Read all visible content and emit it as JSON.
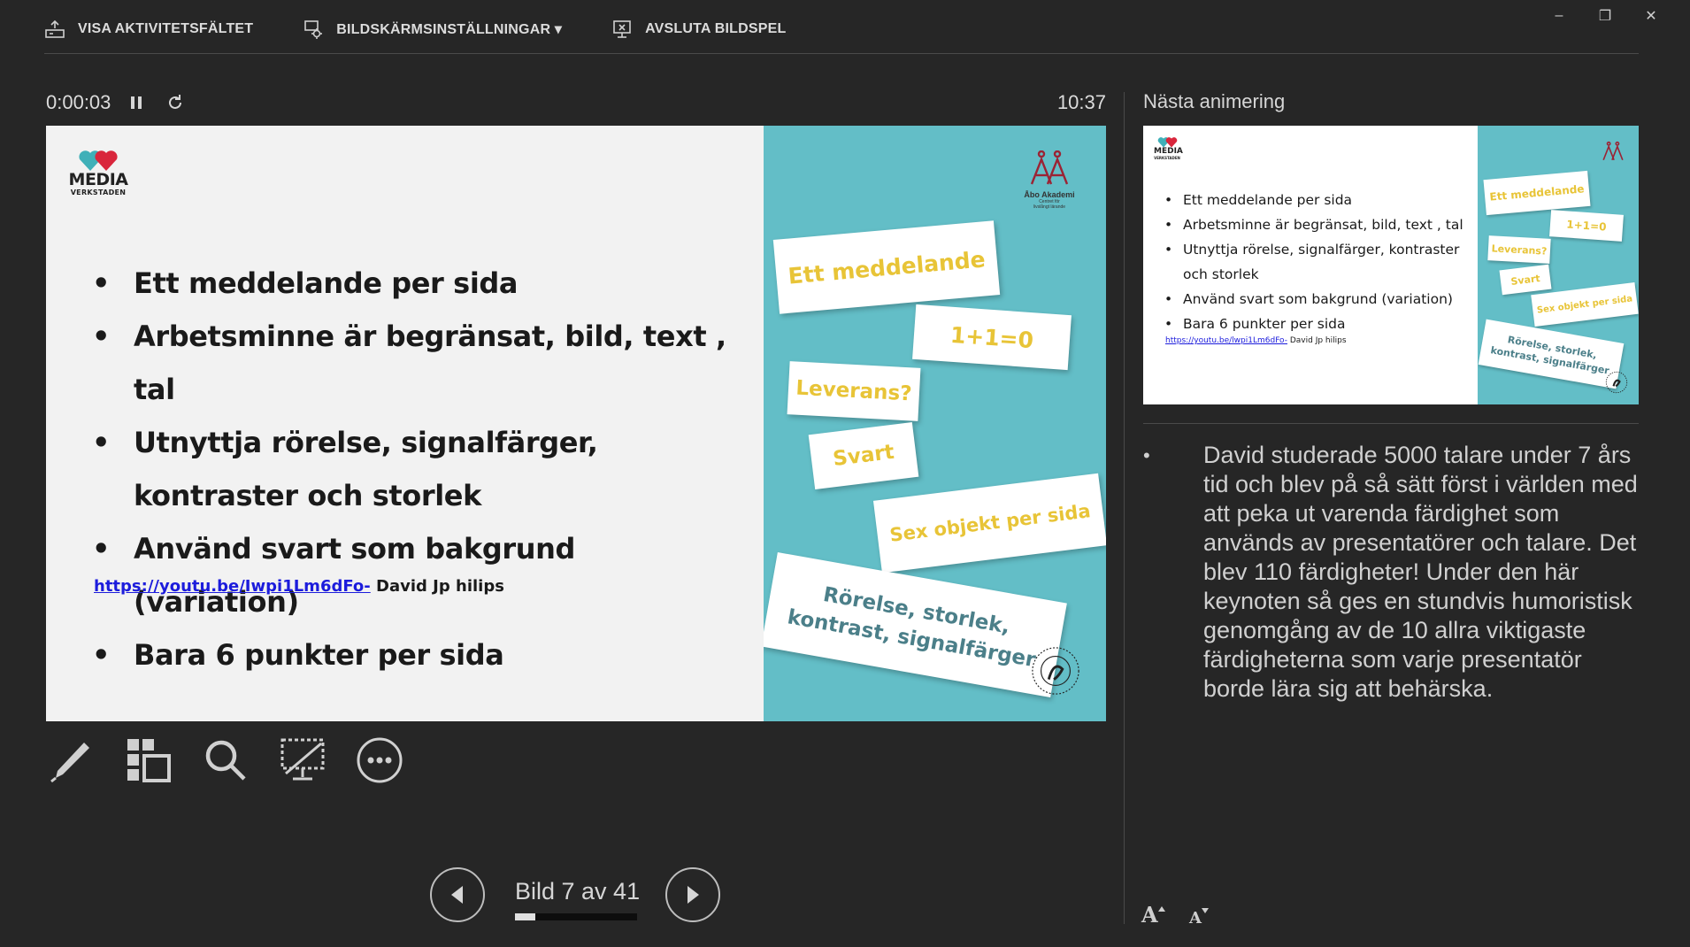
{
  "toolbar": {
    "show_taskbar": "VISA AKTIVITETSFÄLTET",
    "display_settings": "BILDSKÄRMSINSTÄLLNINGAR ▾",
    "end_slideshow": "AVSLUTA BILDSPEL"
  },
  "window_controls": {
    "minimize": "–",
    "restore": "❐",
    "close": "✕"
  },
  "timer": {
    "elapsed": "0:00:03",
    "clock": "10:37"
  },
  "slide": {
    "logo_name": "MEDIA",
    "logo_sub": "VERKSTADEN",
    "bullets": [
      "Ett meddelande per sida",
      "Arbetsminne är begränsat, bild, text , tal",
      "Utnyttja rörelse, signalfärger, kontraster och storlek",
      "Använd svart som bakgrund (variation)",
      "Bara 6 punkter per sida"
    ],
    "link_url": "https://youtu.be/Iwpi1Lm6dFo-",
    "link_author": " David Jp hilips",
    "abo_name": "Åbo Akademi",
    "abo_sub_1": "Centret för",
    "abo_sub_2": "livslångt lärande",
    "cards": {
      "c1": "Ett meddelande",
      "c2": "1+1=0",
      "c3": "Leverans?",
      "c4": "Svart",
      "c5": "Sex objekt per sida",
      "c6_line1": "Rörelse, storlek,",
      "c6_line2": "kontrast, signalfärger"
    }
  },
  "tools": [
    "pen-tool",
    "see-all-slides",
    "zoom",
    "black-screen",
    "more-options"
  ],
  "navigation": {
    "slide_count": "Bild 7 av 41",
    "progress": 0.17
  },
  "next_pane": {
    "title": "Nästa animering",
    "thumb_link_url": "https://youtu.be/lwpi1Lm6dFo-",
    "thumb_link_author": " David Jp hilips"
  },
  "notes": [
    "David studerade 5000 talare under 7 års tid och blev på så sätt först i världen med att peka ut varenda färdighet som används av presentatörer och talare. Det blev 110 färdigheter! Under den här keynoten så ges en stundvis humoristisk genomgång av de 10 allra viktigaste färdigheterna som varje presentatör borde lära sig att behärska."
  ],
  "font_controls": {
    "increase": "A",
    "decrease": "A"
  },
  "colors": {
    "background": "#262626",
    "slide_accent": "#63bec7",
    "card_yellow": "#e8c437",
    "link_blue": "#1c1cdc",
    "heart_teal": "#3fb0b8",
    "heart_red": "#d9263c"
  }
}
